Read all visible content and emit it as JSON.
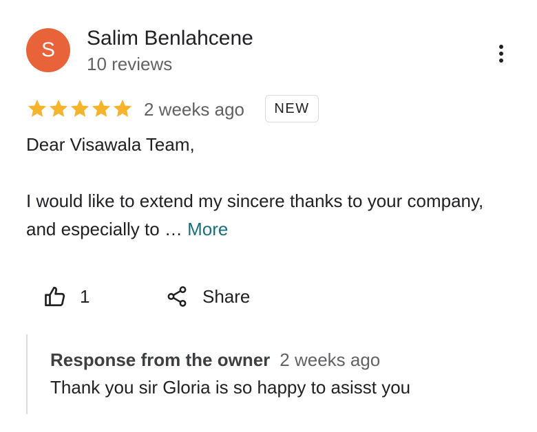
{
  "review": {
    "author": {
      "initial": "S",
      "name": "Salim Benlahcene",
      "reviews_count": "10 reviews"
    },
    "rating": 5,
    "rating_max": 5,
    "date": "2 weeks ago",
    "badge": "NEW",
    "text": {
      "line1": "Dear Visawala Team,",
      "line2": "I would like to extend my sincere thanks to your company, and especially to …",
      "more_label": "More"
    },
    "actions": {
      "like_count": "1",
      "share_label": "Share"
    },
    "owner_response": {
      "title": "Response from the owner",
      "date": "2 weeks ago",
      "text": "Thank you sir Gloria is so happy to asisst you"
    }
  },
  "icons": {
    "avatar_color": "#e8623a",
    "star_color": "#f6b42c",
    "more_link_color": "#1a6f7a",
    "menu": "more-vert-icon",
    "like": "thumb-up-icon",
    "share": "share-icon"
  }
}
